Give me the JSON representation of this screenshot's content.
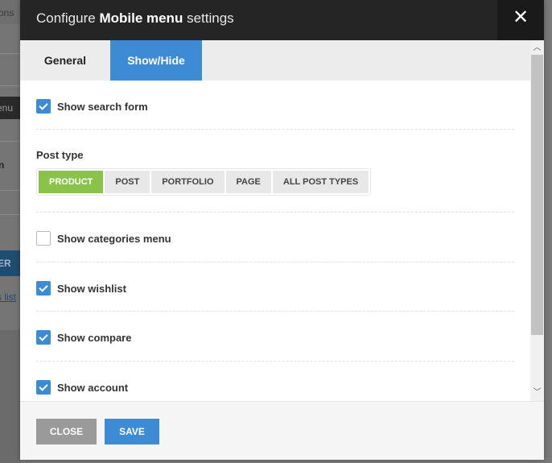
{
  "background": {
    "cell_1": "cons",
    "cell_2": "enu",
    "cell_3": "n",
    "cell_4": "ER",
    "cell_5": "s list"
  },
  "modal": {
    "title_prefix": "Configure ",
    "title_bold": "Mobile menu",
    "title_suffix": " settings",
    "close_glyph": "✕"
  },
  "tabs": [
    {
      "label": "General",
      "active": false
    },
    {
      "label": "Show/Hide",
      "active": true
    }
  ],
  "settings": {
    "show_search_form": {
      "label": "Show search form",
      "checked": true
    },
    "post_type": {
      "label": "Post type",
      "options": [
        "PRODUCT",
        "POST",
        "PORTFOLIO",
        "PAGE",
        "ALL POST TYPES"
      ],
      "selected": "PRODUCT"
    },
    "show_categories_menu": {
      "label": "Show categories menu",
      "checked": false
    },
    "show_wishlist": {
      "label": "Show wishlist",
      "checked": true
    },
    "show_compare": {
      "label": "Show compare",
      "checked": true
    },
    "show_account": {
      "label": "Show account",
      "checked": true
    }
  },
  "footer": {
    "close_label": "CLOSE",
    "save_label": "SAVE"
  },
  "colors": {
    "accent": "#3d8bd4",
    "selected_segment": "#8bc34a",
    "header": "#252525"
  }
}
